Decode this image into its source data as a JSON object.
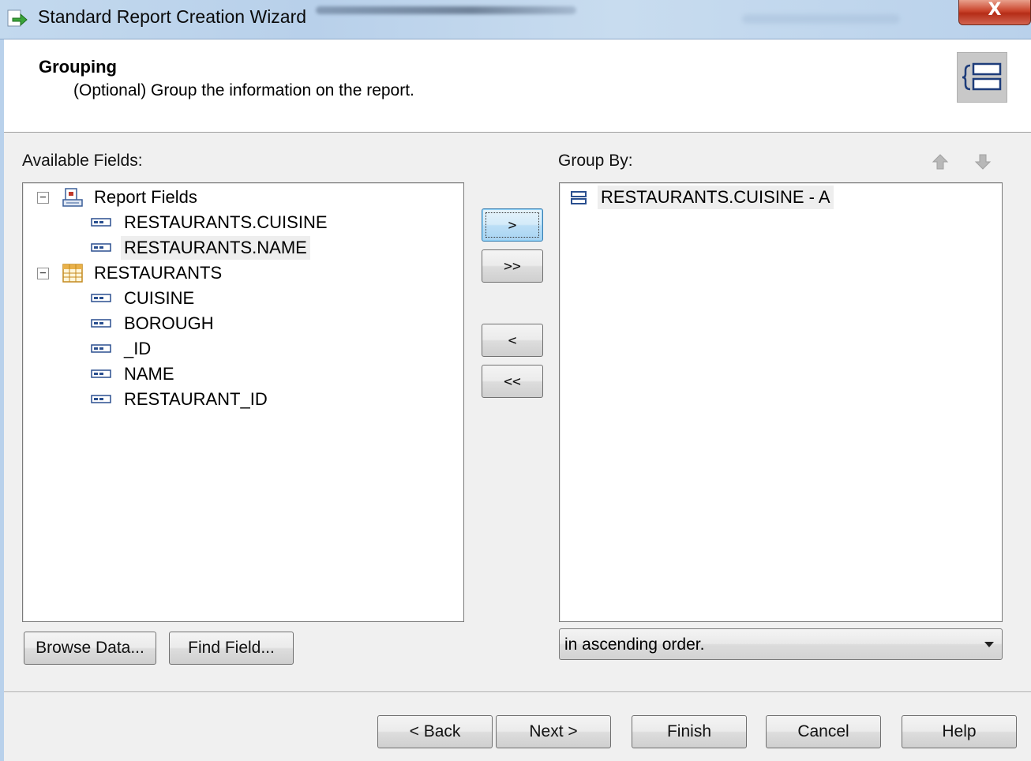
{
  "window": {
    "title": "Standard Report Creation Wizard",
    "close_glyph": "X"
  },
  "header": {
    "title": "Grouping",
    "subtitle": "(Optional) Group the information on the report.",
    "icon": "grouping-icon"
  },
  "available_fields": {
    "label": "Available Fields:",
    "tree": [
      {
        "label": "Report Fields",
        "expander": "−",
        "icon": "report-fields-icon",
        "children": [
          {
            "label": "RESTAURANTS.CUISINE",
            "icon": "field-icon"
          },
          {
            "label": "RESTAURANTS.NAME",
            "icon": "field-icon",
            "selected": true
          }
        ]
      },
      {
        "label": "RESTAURANTS",
        "expander": "−",
        "icon": "table-icon",
        "children": [
          {
            "label": "CUISINE",
            "icon": "field-icon"
          },
          {
            "label": "BOROUGH",
            "icon": "field-icon"
          },
          {
            "label": "_ID",
            "icon": "field-icon"
          },
          {
            "label": "NAME",
            "icon": "field-icon"
          },
          {
            "label": "RESTAURANT_ID",
            "icon": "field-icon"
          }
        ]
      }
    ],
    "browse_button": "Browse Data...",
    "find_button": "Find Field..."
  },
  "transfer_buttons": {
    "add_one": ">",
    "add_all": ">>",
    "remove_one": "<",
    "remove_all": "<<"
  },
  "group_by": {
    "label": "Group By:",
    "items": [
      {
        "label": "RESTAURANTS.CUISINE - A",
        "icon": "group-item-icon"
      }
    ],
    "order_value": "in ascending order.",
    "move_up_icon": "arrow-up-icon",
    "move_down_icon": "arrow-down-icon"
  },
  "footer": {
    "back": "< Back",
    "next": "Next >",
    "finish": "Finish",
    "cancel": "Cancel",
    "help": "Help"
  },
  "colors": {
    "title_bar": "#c3d9ee",
    "close_button": "#c9432b",
    "focus_button": "#bcdff6",
    "icon_blue": "#2a4f8f"
  }
}
